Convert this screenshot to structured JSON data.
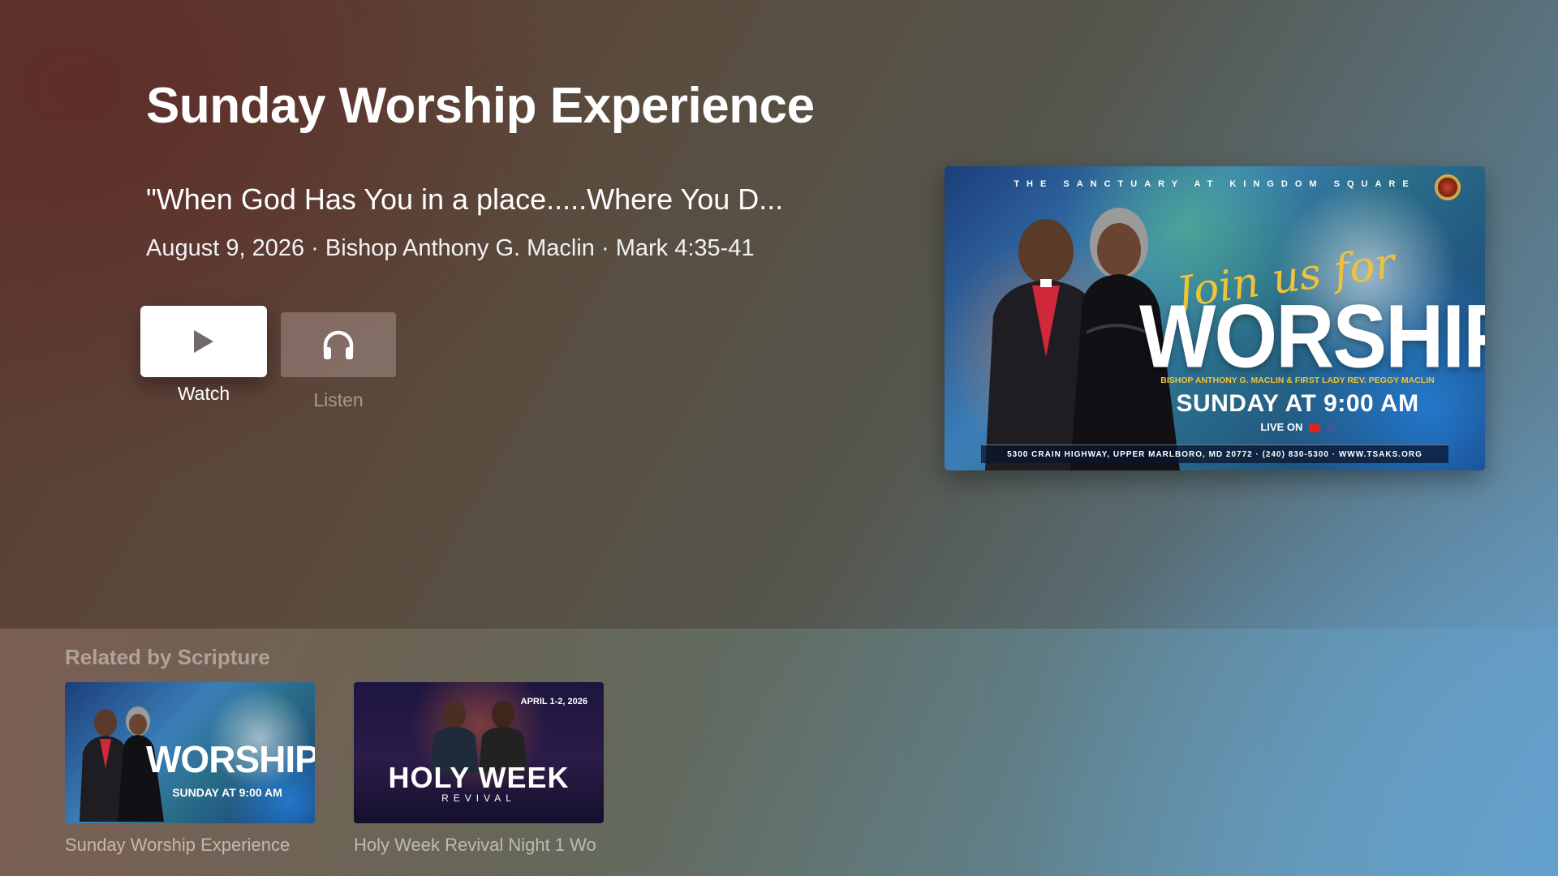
{
  "detail": {
    "title": "Sunday Worship Experience",
    "subtitle": "\"When God Has You in a place.....Where You D...",
    "meta": "August 9, 2026 · Bishop Anthony G. Maclin · Mark 4:35-41"
  },
  "actions": {
    "watch": {
      "label": "Watch",
      "icon": "play-icon"
    },
    "listen": {
      "label": "Listen",
      "icon": "headphones-icon"
    }
  },
  "poster": {
    "top_text": "THE SANCTUARY AT KINGDOM SQUARE",
    "script": "Join us for",
    "headline": "WORSHIP",
    "names": "BISHOP ANTHONY G. MACLIN & FIRST LADY REV. PEGGY MACLIN",
    "time": "SUNDAY AT 9:00 AM",
    "live": "LIVE ON",
    "footer": "5300 CRAIN HIGHWAY, UPPER MARLBORO, MD 20772 · (240) 830-5300 · WWW.TSAKS.ORG"
  },
  "related": {
    "title": "Related by Scripture",
    "items": [
      {
        "label": "Sunday Worship Experience",
        "thumb_headline": "WORSHIP",
        "thumb_time": "SUNDAY AT 9:00 AM"
      },
      {
        "label": "Holy Week Revival Night 1 Wo",
        "thumb_headline": "HOLY WEEK",
        "thumb_sub": "REVIVAL",
        "thumb_date": "APRIL 1-2, 2026"
      }
    ]
  },
  "colors": {
    "background_warm": "#5c3a34",
    "background_cool": "#6b9cc0",
    "poster_gold": "#f0c23a"
  }
}
